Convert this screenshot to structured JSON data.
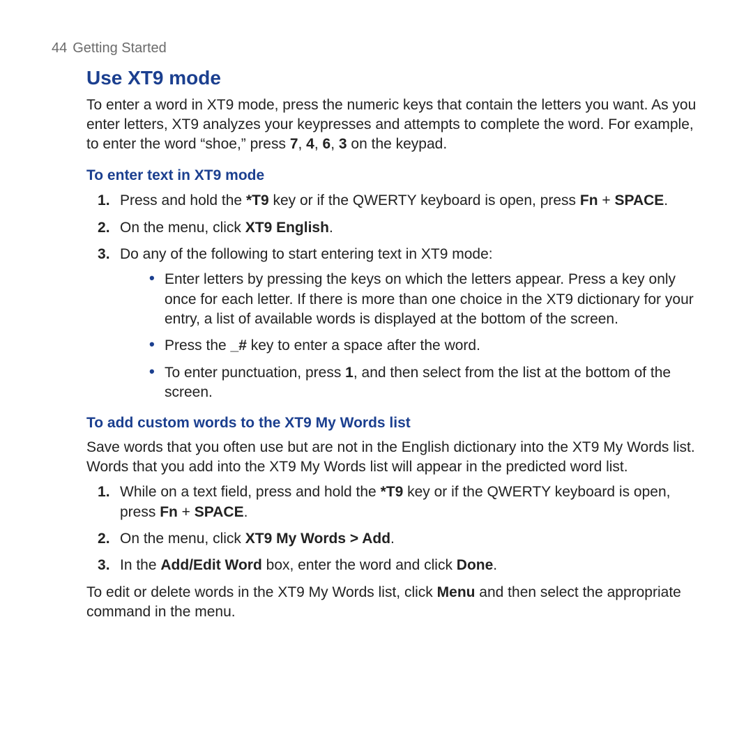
{
  "header": {
    "page_number": "44",
    "chapter": "Getting Started"
  },
  "section": {
    "title": "Use XT9 mode",
    "intro_runs": [
      {
        "t": "To enter a word in XT9 mode, press the numeric keys that contain the letters you want. As you enter letters, XT9 analyzes your keypresses and attempts to complete the word. For example, to enter the word “shoe,” press "
      },
      {
        "t": "7",
        "b": true
      },
      {
        "t": ", "
      },
      {
        "t": "4",
        "b": true
      },
      {
        "t": ", "
      },
      {
        "t": "6",
        "b": true
      },
      {
        "t": ", "
      },
      {
        "t": "3",
        "b": true
      },
      {
        "t": " on the keypad."
      }
    ],
    "sub1": {
      "title": "To enter text in XT9 mode",
      "steps": [
        [
          {
            "t": "Press and hold the "
          },
          {
            "t": "*T9",
            "b": true
          },
          {
            "t": " key or if the QWERTY keyboard is open, press "
          },
          {
            "t": "Fn",
            "b": true
          },
          {
            "t": " + "
          },
          {
            "t": "SPACE",
            "b": true
          },
          {
            "t": "."
          }
        ],
        [
          {
            "t": "On the menu, click "
          },
          {
            "t": "XT9 English",
            "b": true
          },
          {
            "t": "."
          }
        ],
        [
          {
            "t": "Do any of the following to start entering text in XT9 mode:"
          }
        ]
      ],
      "bullets": [
        [
          {
            "t": "Enter letters by pressing the keys on which the letters appear. Press a key only once for each letter. If there is more than one choice in the XT9 dictionary for your entry, a list of available words is displayed at the bottom of the screen."
          }
        ],
        [
          {
            "t": "Press the "
          },
          {
            "t": "_#",
            "b": true
          },
          {
            "t": " key to enter a space after the word."
          }
        ],
        [
          {
            "t": "To enter punctuation, press "
          },
          {
            "t": "1",
            "b": true
          },
          {
            "t": ", and then select from the list at the bottom of the screen."
          }
        ]
      ]
    },
    "sub2": {
      "title": "To add custom words to the XT9 My Words list",
      "intro": "Save words that you often use but are not in the English dictionary into the XT9 My Words list. Words that you add into the XT9 My Words list will appear in the predicted word list.",
      "steps": [
        [
          {
            "t": "While on a text field, press and hold the "
          },
          {
            "t": "*T9",
            "b": true
          },
          {
            "t": " key or if the QWERTY keyboard is open, press "
          },
          {
            "t": "Fn",
            "b": true
          },
          {
            "t": " + "
          },
          {
            "t": "SPACE",
            "b": true
          },
          {
            "t": "."
          }
        ],
        [
          {
            "t": "On the menu, click "
          },
          {
            "t": "XT9 My Words > Add",
            "b": true
          },
          {
            "t": "."
          }
        ],
        [
          {
            "t": "In the "
          },
          {
            "t": "Add/Edit Word",
            "b": true
          },
          {
            "t": " box, enter the word and click "
          },
          {
            "t": "Done",
            "b": true
          },
          {
            "t": "."
          }
        ]
      ],
      "outro_runs": [
        {
          "t": "To edit or delete words in the XT9 My Words list, click "
        },
        {
          "t": "Menu",
          "b": true
        },
        {
          "t": " and then select the appropriate command in the menu."
        }
      ]
    }
  }
}
